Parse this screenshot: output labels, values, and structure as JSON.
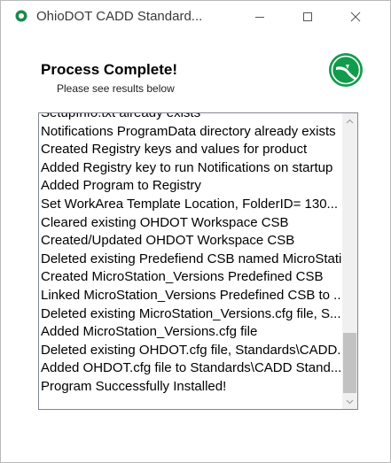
{
  "window": {
    "title": "OhioDOT CADD Standard...",
    "minimize_icon": "minimize-icon",
    "maximize_icon": "maximize-icon",
    "close_icon": "close-icon",
    "app_icon": "ohiodot-app-icon",
    "app_icon_color": "#1a8a4a"
  },
  "header": {
    "heading": "Process Complete!",
    "subheading": "Please see results below",
    "logo_icon": "ohio-logo-icon",
    "logo_color": "#129b4d"
  },
  "results": {
    "items": [
      "SetupInfo.txt already exists",
      "Notifications ProgramData directory already exists",
      "Created Registry keys and values for product",
      "Added Registry key to run Notifications on startup",
      "Added Program to Registry",
      "Set WorkArea Template Location, FolderID= 130...",
      "Cleared existing OHDOT Workspace CSB",
      "Created/Updated OHDOT Workspace CSB",
      "Deleted existing Predefiend CSB named MicroStation_Versions",
      "Created MicroStation_Versions Predefined CSB",
      "Linked MicroStation_Versions Predefined CSB to ...",
      "Deleted existing MicroStation_Versions.cfg file, S...",
      "Added MicroStation_Versions.cfg file",
      "Deleted existing OHDOT.cfg file, Standards\\CADD...",
      "Added OHDOT.cfg file to Standards\\CADD Stand...",
      "Program Successfully Installed!"
    ],
    "scroll_position": 0.85
  },
  "colors": {
    "list_border": "#828790",
    "scroll_thumb": "#c2c2c2"
  }
}
